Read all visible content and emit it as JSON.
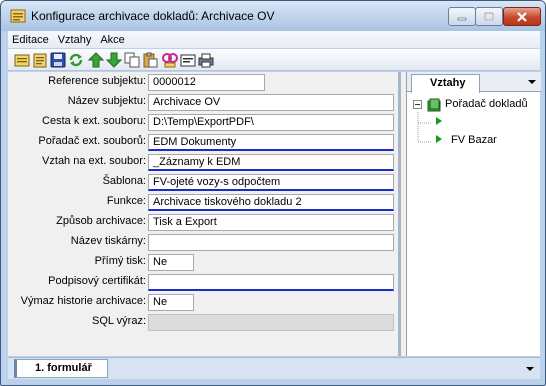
{
  "window": {
    "title": "Konfigurace archivace dokladů: Archivace OV"
  },
  "menu": [
    "Editace",
    "Vztahy",
    "Akce"
  ],
  "toolbar": {
    "icons": [
      "new-icon",
      "open-icon",
      "save-icon",
      "refresh-icon",
      "up-arrow-icon",
      "down-arrow-icon",
      "copy-icon",
      "paste-icon",
      "link-icon",
      "card-icon",
      "print-icon"
    ]
  },
  "form": {
    "fields": [
      {
        "label": "Reference subjektu:",
        "value": "0000012"
      },
      {
        "label": "Název subjektu:",
        "value": "Archivace OV"
      },
      {
        "label": "Cesta k ext. souboru:",
        "value": "D:\\Temp\\ExportPDF\\"
      },
      {
        "label": "Pořadač ext. souborů:",
        "value": "EDM Dokumenty"
      },
      {
        "label": "Vztah na ext. soubor:",
        "value": "_Záznamy k EDM"
      },
      {
        "label": "Šablona:",
        "value": "FV-ojeté vozy-s odpočtem"
      },
      {
        "label": "Funkce:",
        "value": "Archivace tiskového dokladu 2"
      },
      {
        "label": "Způsob archivace:",
        "value": "Tisk a Export"
      },
      {
        "label": "Název tiskárny:",
        "value": ""
      },
      {
        "label": "Přímý tisk:",
        "value": "Ne"
      },
      {
        "label": "Podpisový certifikát:",
        "value": ""
      },
      {
        "label": "Výmaz historie archivace:",
        "value": "Ne"
      },
      {
        "label": "SQL výraz:",
        "value": ""
      }
    ]
  },
  "relations": {
    "tab_label": "Vztahy",
    "tree": {
      "root_label": "Pořadač dokladů",
      "children": [
        "",
        "FV Bazar"
      ]
    }
  },
  "bottom": {
    "tab_label": "1. formulář"
  }
}
